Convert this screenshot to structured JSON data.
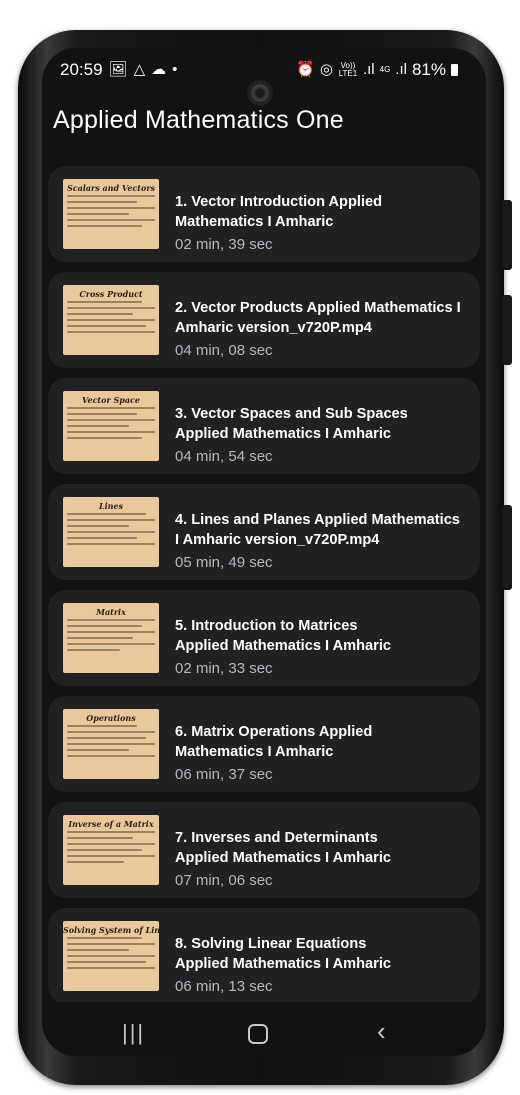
{
  "status_bar": {
    "time": "20:59",
    "left_icons": [
      "image-icon",
      "drive-icon",
      "cloud-icon",
      "dot-icon"
    ],
    "volte": "Vo)) LTE1",
    "network": "4G",
    "battery": "81%"
  },
  "header": {
    "title": "Applied Mathematics One"
  },
  "videos": [
    {
      "title": "1. Vector Introduction  Applied\nMathematics I  Amharic",
      "duration": "02 min, 39 sec",
      "thumb_heading": "Scalars and Vectors"
    },
    {
      "title": "2. Vector Products  Applied Mathematics I\nAmharic version_v720P.mp4",
      "duration": "04 min, 08 sec",
      "thumb_heading": "Cross Product"
    },
    {
      "title": "3. Vector Spaces and Sub Spaces\nApplied Mathematics I  Amharic",
      "duration": "04 min, 54 sec",
      "thumb_heading": "Vector Space"
    },
    {
      "title": "4. Lines and Planes  Applied Mathematics\nI  Amharic version_v720P.mp4",
      "duration": "05 min, 49 sec",
      "thumb_heading": "Lines"
    },
    {
      "title": "5. Introduction to Matrices\nApplied Mathematics I  Amharic",
      "duration": "02 min, 33 sec",
      "thumb_heading": "Matrix"
    },
    {
      "title": "6. Matrix Operations  Applied\nMathematics I  Amharic",
      "duration": "06 min, 37 sec",
      "thumb_heading": "Operations"
    },
    {
      "title": "7. Inverses and Determinants\nApplied Mathematics I  Amharic",
      "duration": "07 min, 06 sec",
      "thumb_heading": "Inverse of a Matrix"
    },
    {
      "title": "8. Solving Linear Equations\nApplied Mathematics I  Amharic",
      "duration": "06 min, 13 sec",
      "thumb_heading": "Solving System of Linear Equations"
    }
  ],
  "nav_bar": {
    "recent_icon": "recent-apps-icon",
    "home_icon": "home-icon",
    "back_icon": "back-icon"
  },
  "colors": {
    "background": "#121212",
    "card": "#212124",
    "text_primary": "#ffffff",
    "text_secondary": "#b8b8bb",
    "thumbnail": "#e9c99b"
  }
}
